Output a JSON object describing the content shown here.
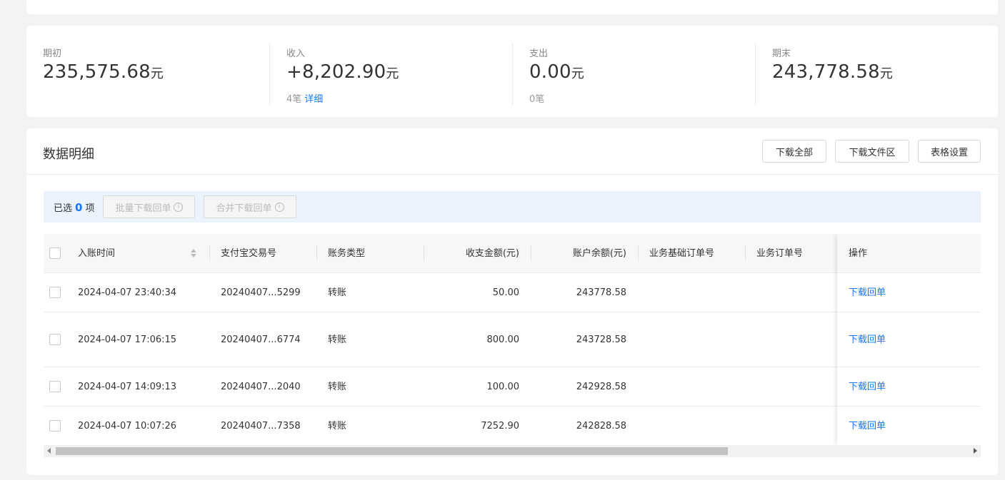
{
  "summary": [
    {
      "label": "期初",
      "value": "235,575.68",
      "unit": "元",
      "sub_text": "",
      "sub_link": ""
    },
    {
      "label": "收入",
      "value": "+8,202.90",
      "unit": "元",
      "sub_text": "4笔",
      "sub_link": "详细"
    },
    {
      "label": "支出",
      "value": "0.00",
      "unit": "元",
      "sub_text": "0笔",
      "sub_link": ""
    },
    {
      "label": "期末",
      "value": "243,778.58",
      "unit": "元",
      "sub_text": "",
      "sub_link": ""
    }
  ],
  "detail": {
    "title": "数据明细",
    "buttons": {
      "download_all": "下载全部",
      "download_area": "下载文件区",
      "table_settings": "表格设置"
    }
  },
  "selection": {
    "prefix": "已选",
    "count": "0",
    "suffix": "项",
    "batch_download": "批量下载回单",
    "merge_download": "合并下载回单"
  },
  "table": {
    "columns": {
      "time": "入账时间",
      "trade_no": "支付宝交易号",
      "type": "账务类型",
      "amount": "收支金额(元)",
      "balance": "账户余额(元)",
      "base_order": "业务基础订单号",
      "order": "业务订单号",
      "action": "操作"
    },
    "rows": [
      {
        "time": "2024-04-07 23:40:34",
        "trade_no": "20240407...5299",
        "type": "转账",
        "amount": "50.00",
        "balance": "243778.58",
        "action": "下载回单"
      },
      {
        "time": "2024-04-07 17:06:15",
        "trade_no": "20240407...6774",
        "type": "转账",
        "amount": "800.00",
        "balance": "243728.58",
        "action": "下载回单"
      },
      {
        "time": "2024-04-07 14:09:13",
        "trade_no": "20240407...2040",
        "type": "转账",
        "amount": "100.00",
        "balance": "242928.58",
        "action": "下载回单"
      },
      {
        "time": "2024-04-07 10:07:26",
        "trade_no": "20240407...7358",
        "type": "转账",
        "amount": "7252.90",
        "balance": "242828.58",
        "action": "下载回单"
      }
    ]
  }
}
